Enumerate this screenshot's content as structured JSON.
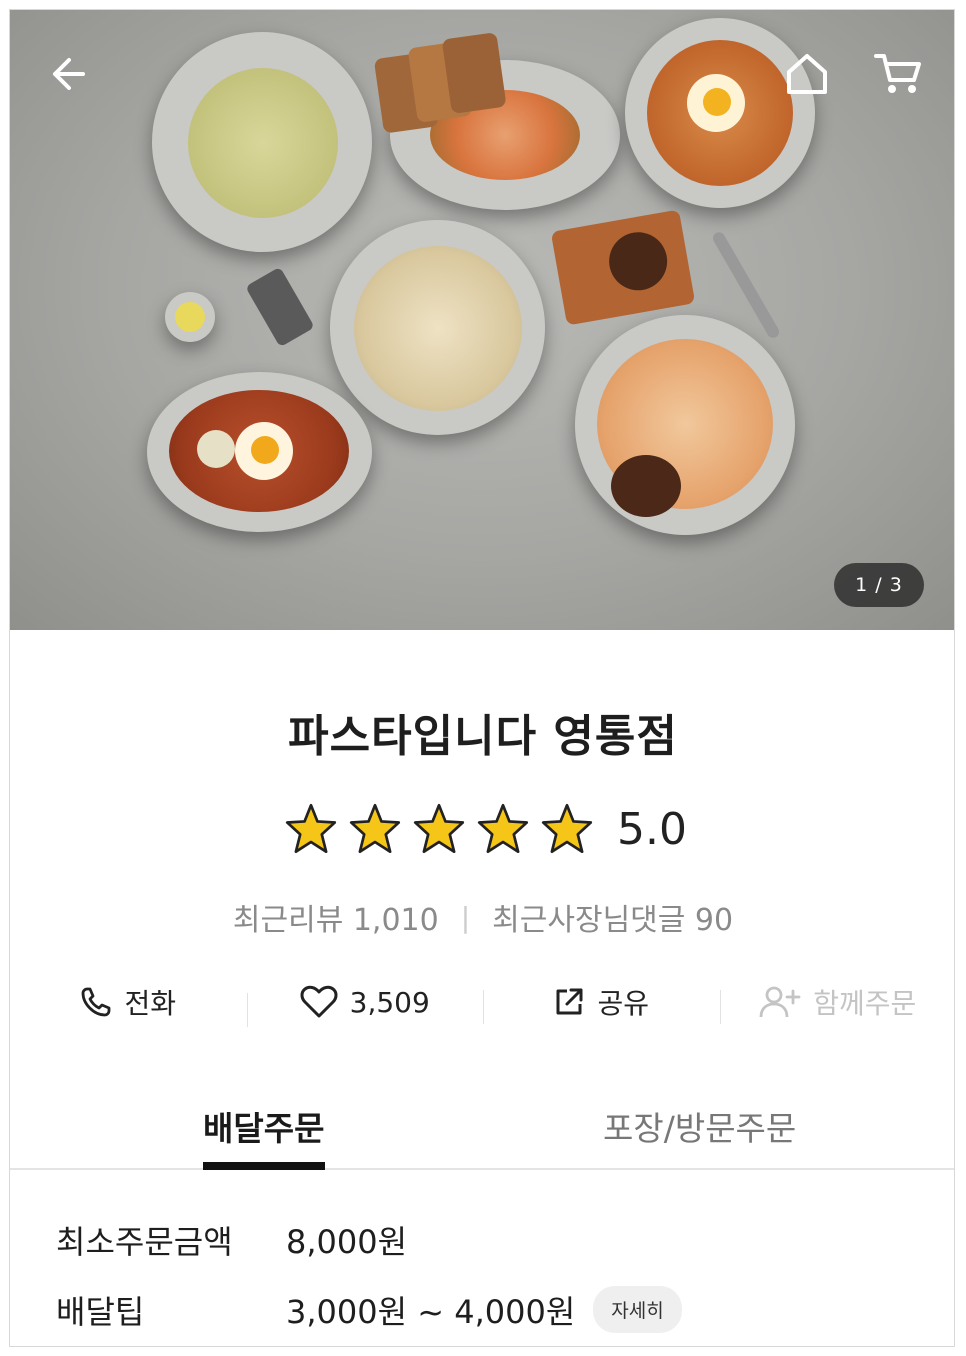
{
  "hero": {
    "image_alt": "pasta dishes spread",
    "counter": "1 / 3"
  },
  "nav": {
    "back_icon": "back-arrow-icon",
    "home_icon": "home-icon",
    "cart_icon": "cart-icon"
  },
  "store": {
    "name": "파스타입니다 영통점",
    "rating": "5.0",
    "stars": 5,
    "recent_reviews_label": "최근리뷰",
    "recent_reviews_count": "1,010",
    "owner_replies_label": "최근사장님댓글",
    "owner_replies_count": "90"
  },
  "actions": {
    "call": "전화",
    "likes": "3,509",
    "share": "공유",
    "group_order": "함께주문"
  },
  "tabs": {
    "delivery": "배달주문",
    "pickup": "포장/방문주문"
  },
  "info": {
    "min_order_label": "최소주문금액",
    "min_order_value": "8,000원",
    "delivery_tip_label": "배달팁",
    "delivery_tip_value": "3,000원 ~ 4,000원",
    "detail_button": "자세히"
  },
  "colors": {
    "star": "#f5c518",
    "text": "#222222",
    "muted": "#8a8a8a"
  }
}
